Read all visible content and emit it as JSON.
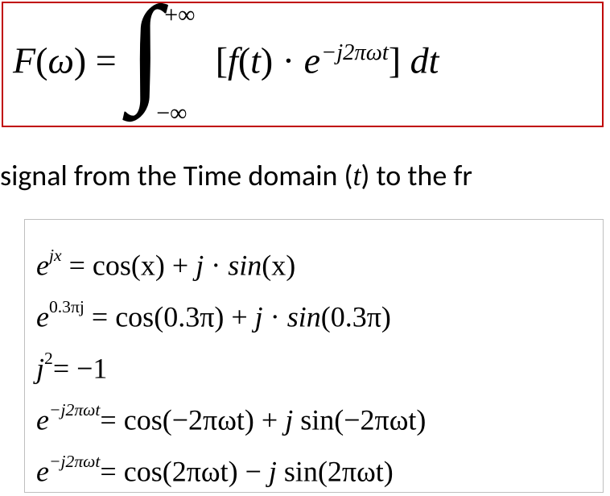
{
  "main_formula": {
    "lhs_F": "F",
    "lhs_open": "(",
    "lhs_omega": "ω",
    "lhs_close": ")",
    "eq": " = ",
    "int_top": "+∞",
    "int_bot": "−∞",
    "open_br": "[",
    "f": "f",
    "f_open": "(",
    "t": "t",
    "f_close": ")",
    "dot": " · ",
    "e": "e",
    "exp": "−j2πωt",
    "close_br": "]",
    "space": " ",
    "d": "d",
    "t2": "t"
  },
  "body": {
    "pre": "signal from the Time domain (",
    "t": "t",
    "post": ") to the fr"
  },
  "eq1": {
    "e": "e",
    "sup": "jx",
    "eq": " = ",
    "cos": "cos",
    "arg1": "(x)",
    "plus": " + ",
    "j": "j",
    "dot": " · ",
    "sin": "sin",
    "arg2": "(x)"
  },
  "eq2": {
    "e": "e",
    "sup": "0.3πj",
    "eq": " = ",
    "cos": "cos",
    "arg1": "(0.3π)",
    "plus": " + ",
    "j": "j",
    "dot": " · ",
    "sin": "sin",
    "arg2": "(0.3π)"
  },
  "eq3": {
    "j": "j",
    "sup": "2",
    "eq": "= −1"
  },
  "eq4": {
    "e": "e",
    "sup": "−j2πωt",
    "eq": "= ",
    "cos": "cos",
    "arg1": "(−2πωt)",
    "plus": " + ",
    "j": "j",
    "sin": " sin",
    "arg2": "(−2πωt)"
  },
  "eq5": {
    "e": "e",
    "sup": "−j2πωt",
    "eq": "= ",
    "cos": "cos",
    "arg1": "(2πωt)",
    "minus": " − ",
    "j": "j",
    "sin": " sin",
    "arg2": "(2πωt)"
  }
}
